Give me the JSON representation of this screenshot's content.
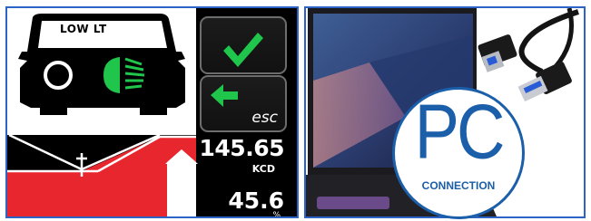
{
  "display": {
    "mode_label": "LOW LT",
    "confirm_icon": "check-icon",
    "back_icon": "left-arrow-icon",
    "esc_label": "esc",
    "reading_value": "145.65",
    "reading_unit": "KCD",
    "percent_value": "45.6",
    "percent_unit": "%",
    "colors": {
      "green": "#1fc64b",
      "red": "#e8262e",
      "frame": "#2b63c6"
    }
  },
  "promo": {
    "badge_title": "PC",
    "badge_subtitle": "CONNECTION",
    "colors": {
      "badge_blue": "#1b5ea9"
    }
  }
}
